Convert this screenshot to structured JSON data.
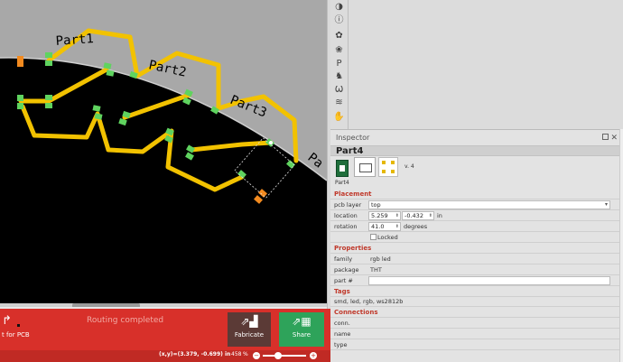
{
  "canvas": {
    "part_labels": [
      "Part1",
      "Part2",
      "Part3",
      "Pa"
    ]
  },
  "toolbar": {
    "route_label": "t for PCB",
    "routing_status": "Routing completed",
    "fabricate_label": "Fabricate",
    "share_label": "Share"
  },
  "status": {
    "coords": "(x,y)=(3.379, -0.699) in",
    "zoom": "458",
    "zoom_unit": "%",
    "zoom_slider_fraction": 0.35
  },
  "parts_bin": {
    "icons": [
      "sparkfun-icon",
      "intel-icon",
      "seeed-flower-icon",
      "dark-flower-icon",
      "pa-icon",
      "moose-icon",
      "lilypad-icon",
      "seeed-icon",
      "hand-icon"
    ]
  },
  "inspector": {
    "title": "Inspector",
    "part_title": "Part4",
    "version": "v. 4",
    "image_caption": "Part4",
    "placement": {
      "section": "Placement",
      "pcb_layer_label": "pcb layer",
      "pcb_layer_value": "top",
      "location_label": "location",
      "location_x": "5.259",
      "location_y": "-0.432",
      "location_unit": "in",
      "rotation_label": "rotation",
      "rotation_value": "41.0",
      "rotation_unit": "degrees",
      "locked_label": "Locked"
    },
    "properties": {
      "section": "Properties",
      "family_label": "family",
      "family_value": "rgb led",
      "package_label": "package",
      "package_value": "THT",
      "part_number_label": "part #",
      "part_number_value": ""
    },
    "tags": {
      "section": "Tags",
      "value": "smd, led, rgb, ws2812b"
    },
    "connections": {
      "section": "Connections",
      "conn_label": "conn.",
      "name_label": "name",
      "type_label": "type"
    }
  },
  "colors": {
    "trace": "#f2c200",
    "pad_green": "#5fd35f",
    "pad_orange": "#f28a1f",
    "board": "#000000",
    "toolbar_red": "#d8302a",
    "share_green": "#2ea35a",
    "section_red": "#c0392b"
  }
}
